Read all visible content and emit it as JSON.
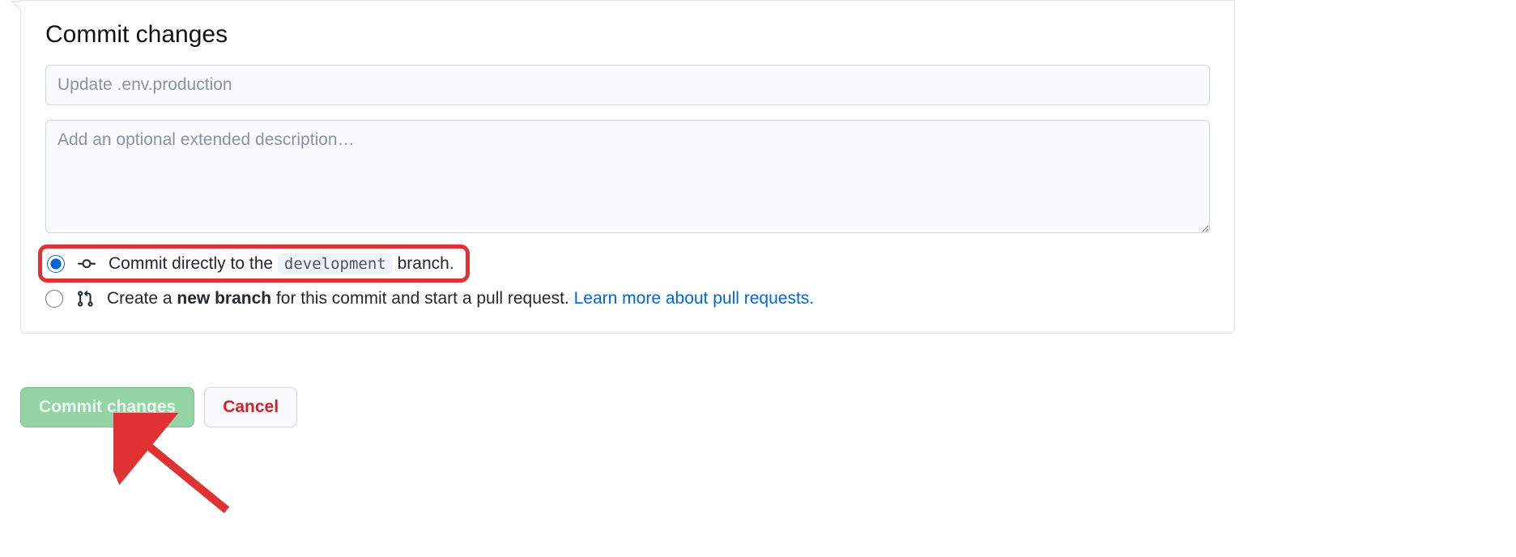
{
  "heading": "Commit changes",
  "summary": {
    "value": "",
    "placeholder": "Update .env.production"
  },
  "description": {
    "value": "",
    "placeholder": "Add an optional extended description…"
  },
  "option_direct": {
    "prefix": "Commit directly to the",
    "branch": "development",
    "suffix": "branch."
  },
  "option_newbranch": {
    "prefix": "Create a",
    "bold": "new branch",
    "middle": "for this commit and start a pull request.",
    "link": "Learn more about pull requests."
  },
  "buttons": {
    "commit": "Commit changes",
    "cancel": "Cancel"
  }
}
